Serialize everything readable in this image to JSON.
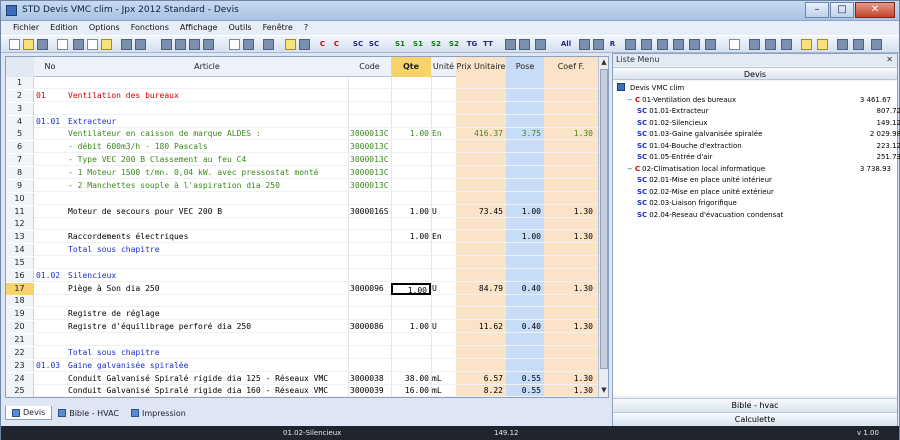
{
  "window": {
    "title": "STD Devis VMC clim - Jpx 2012 Standard - Devis",
    "minimize": "–",
    "maximize": "□",
    "close": "✕"
  },
  "menu": [
    "Fichier",
    "Edition",
    "Options",
    "Fonctions",
    "Affichage",
    "Outils",
    "Fenêtre",
    "?"
  ],
  "toolbar_text_buttons": [
    "C",
    "C",
    "SC",
    "SC",
    "S1",
    "S1",
    "S2",
    "S2",
    "TG",
    "TT",
    "All",
    "R"
  ],
  "columns": {
    "no": "No",
    "article": "Article",
    "code": "Code",
    "qte": "Qte",
    "unite": "Unité",
    "pu": "Prix Unitaire",
    "pose": "Pose",
    "coef": "Coef F."
  },
  "rows": [
    {
      "n": "1",
      "no": "",
      "art": "",
      "code": "",
      "qte": "",
      "u": "",
      "pu": "",
      "pose": "",
      "coef": "",
      "cls": ""
    },
    {
      "n": "2",
      "no": "01",
      "art": "Ventilation des bureaux",
      "code": "",
      "qte": "",
      "u": "",
      "pu": "",
      "pose": "",
      "coef": "",
      "cls": "red-t"
    },
    {
      "n": "3",
      "no": "",
      "art": "",
      "code": "",
      "qte": "",
      "u": "",
      "pu": "",
      "pose": "",
      "coef": "",
      "cls": ""
    },
    {
      "n": "4",
      "no": "01.01",
      "art": "Extracteur",
      "code": "",
      "qte": "",
      "u": "",
      "pu": "",
      "pose": "",
      "coef": "",
      "cls": "blue-t"
    },
    {
      "n": "5",
      "no": "",
      "art": "Ventilateur en caisson de marque ALDES :",
      "code": "3000013C",
      "qte": "1.00",
      "u": "En",
      "pu": "416.37",
      "pose": "3.75",
      "coef": "1.30",
      "cls": "grn-t"
    },
    {
      "n": "6",
      "no": "",
      "art": "- débit 600m3/h - 180 Pascals",
      "code": "3000013C",
      "qte": "",
      "u": "",
      "pu": "",
      "pose": "",
      "coef": "",
      "cls": "grn-t"
    },
    {
      "n": "7",
      "no": "",
      "art": "- Type VEC 200 B Classement au feu C4",
      "code": "3000013C",
      "qte": "",
      "u": "",
      "pu": "",
      "pose": "",
      "coef": "",
      "cls": "grn-t"
    },
    {
      "n": "8",
      "no": "",
      "art": "- 1 Moteur 1500 t/mn. 0,04 kW. avec pressostat monté",
      "code": "3000013C",
      "qte": "",
      "u": "",
      "pu": "",
      "pose": "",
      "coef": "",
      "cls": "grn-t"
    },
    {
      "n": "9",
      "no": "",
      "art": "- 2 Manchettes souple à l'aspiration dia 250",
      "code": "3000013C",
      "qte": "",
      "u": "",
      "pu": "",
      "pose": "",
      "coef": "",
      "cls": "grn-t"
    },
    {
      "n": "10",
      "no": "",
      "art": "",
      "code": "",
      "qte": "",
      "u": "",
      "pu": "",
      "pose": "",
      "coef": "",
      "cls": ""
    },
    {
      "n": "11",
      "no": "",
      "art": "Moteur de secours pour VEC 200 B",
      "code": "3000016S",
      "qte": "1.00",
      "u": "U",
      "pu": "73.45",
      "pose": "1.00",
      "coef": "1.30",
      "cls": ""
    },
    {
      "n": "12",
      "no": "",
      "art": "",
      "code": "",
      "qte": "",
      "u": "",
      "pu": "",
      "pose": "",
      "coef": "",
      "cls": ""
    },
    {
      "n": "13",
      "no": "",
      "art": "Raccordements électriques",
      "code": "",
      "qte": "1.00",
      "u": "En",
      "pu": "",
      "pose": "1.00",
      "coef": "1.30",
      "cls": ""
    },
    {
      "n": "14",
      "no": "",
      "art": "        Total sous chapitre",
      "code": "",
      "qte": "",
      "u": "",
      "pu": "",
      "pose": "",
      "coef": "",
      "cls": "blue-t"
    },
    {
      "n": "15",
      "no": "",
      "art": "",
      "code": "",
      "qte": "",
      "u": "",
      "pu": "",
      "pose": "",
      "coef": "",
      "cls": ""
    },
    {
      "n": "16",
      "no": "01.02",
      "art": "Silencieux",
      "code": "",
      "qte": "",
      "u": "",
      "pu": "",
      "pose": "",
      "coef": "",
      "cls": "blue-t"
    },
    {
      "n": "17",
      "no": "",
      "art": "Piège à Son dia 250",
      "code": "3000096",
      "qte": "1.00",
      "u": "U",
      "pu": "84.79",
      "pose": "0.40",
      "coef": "1.30",
      "cls": "",
      "sel": true
    },
    {
      "n": "18",
      "no": "",
      "art": "",
      "code": "",
      "qte": "",
      "u": "",
      "pu": "",
      "pose": "",
      "coef": "",
      "cls": ""
    },
    {
      "n": "19",
      "no": "",
      "art": "Registre de réglage",
      "code": "",
      "qte": "",
      "u": "",
      "pu": "",
      "pose": "",
      "coef": "",
      "cls": ""
    },
    {
      "n": "20",
      "no": "",
      "art": "Registre d'équilibrage perforé dia 250",
      "code": "3000086",
      "qte": "1.00",
      "u": "U",
      "pu": "11.62",
      "pose": "0.40",
      "coef": "1.30",
      "cls": ""
    },
    {
      "n": "21",
      "no": "",
      "art": "",
      "code": "",
      "qte": "",
      "u": "",
      "pu": "",
      "pose": "",
      "coef": "",
      "cls": ""
    },
    {
      "n": "22",
      "no": "",
      "art": "        Total sous chapitre",
      "code": "",
      "qte": "",
      "u": "",
      "pu": "",
      "pose": "",
      "coef": "",
      "cls": "blue-t"
    },
    {
      "n": "23",
      "no": "01.03",
      "art": "Gaine galvanisée spiralée",
      "code": "",
      "qte": "",
      "u": "",
      "pu": "",
      "pose": "",
      "coef": "",
      "cls": "blue-t"
    },
    {
      "n": "24",
      "no": "",
      "art": "Conduit Galvanisé Spiralé rigide dia 125 - Réseaux VMC",
      "code": "3000038",
      "qte": "38.00",
      "u": "mL",
      "pu": "6.57",
      "pose": "0.55",
      "coef": "1.30",
      "cls": ""
    },
    {
      "n": "25",
      "no": "",
      "art": "Conduit Galvanisé Spiralé rigide dia 160 - Réseaux VMC",
      "code": "3000039",
      "qte": "16.00",
      "u": "mL",
      "pu": "8.22",
      "pose": "0.55",
      "coef": "1.30",
      "cls": ""
    }
  ],
  "tabs": [
    "Devis",
    "Bible - HVAC",
    "Impression"
  ],
  "panel": {
    "title": "Liste Menu",
    "close": "✕",
    "header": "Devis",
    "tree": [
      {
        "lvl": 0,
        "badge": "",
        "label": "Devis VMC clim",
        "amt": ""
      },
      {
        "lvl": 1,
        "badge": "C",
        "label": "01-Ventilation des bureaux",
        "amt": "3 461.67"
      },
      {
        "lvl": 2,
        "badge": "SC",
        "label": "01.01-Extracteur",
        "amt": "807.72"
      },
      {
        "lvl": 2,
        "badge": "SC",
        "label": "01.02-Silencieux",
        "amt": "149.12"
      },
      {
        "lvl": 2,
        "badge": "SC",
        "label": "01.03-Gaine galvanisée spiralée",
        "amt": "2 029.98"
      },
      {
        "lvl": 2,
        "badge": "SC",
        "label": "01.04-Bouche d'extraction",
        "amt": "223.12"
      },
      {
        "lvl": 2,
        "badge": "SC",
        "label": "01.05-Entrée d'air",
        "amt": "251.73"
      },
      {
        "lvl": 1,
        "badge": "C",
        "label": "02-Climatisation local informatique",
        "amt": "3 738.93"
      },
      {
        "lvl": 2,
        "badge": "SC",
        "label": "02.01-Mise en place unité intérieur",
        "amt": ""
      },
      {
        "lvl": 2,
        "badge": "SC",
        "label": "02.02-Mise en place unité extérieur",
        "amt": ""
      },
      {
        "lvl": 2,
        "badge": "SC",
        "label": "02.03-Liaison frigorifique",
        "amt": ""
      },
      {
        "lvl": 2,
        "badge": "SC",
        "label": "02.04-Reseau d'évacuation condensat",
        "amt": ""
      }
    ],
    "btn_bible": "Bible - hvac",
    "btn_calc": "Calculette"
  },
  "status": {
    "section": "01.02-Silencieux",
    "amount": "149.12",
    "version": "v 1.00"
  },
  "colors": {
    "qte_header": "#f6d46a",
    "pu_col": "#fbe3c8",
    "pose_col": "#c7dcf6",
    "coef_col": "#fbe3c8",
    "chapter": "#d00000",
    "subchapter": "#1a2fd0",
    "detail": "#3a8a1a"
  }
}
